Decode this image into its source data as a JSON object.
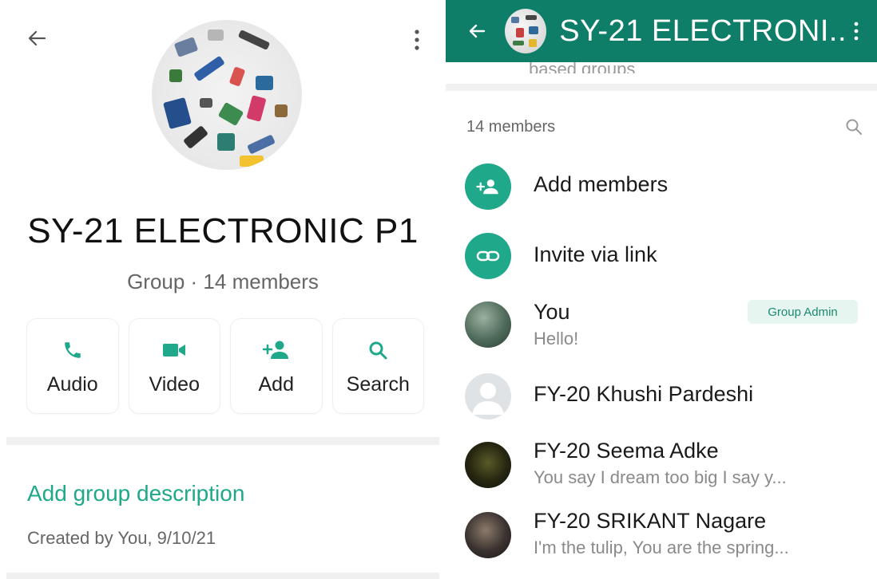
{
  "left": {
    "group_name": "SY-21 ELECTRONIC P1",
    "group_subtitle": "Group · 14 members",
    "actions": [
      {
        "label": "Audio",
        "icon": "phone-icon"
      },
      {
        "label": "Video",
        "icon": "video-icon"
      },
      {
        "label": "Add",
        "icon": "add-person-icon"
      },
      {
        "label": "Search",
        "icon": "search-icon"
      }
    ],
    "description_link": "Add group description",
    "created_by": "Created by You, 9/10/21"
  },
  "right": {
    "title": "SY-21 ELECTRONI..",
    "cut_text": "based groups",
    "members_count": "14 members",
    "add_members": "Add members",
    "invite_link": "Invite via link",
    "members": [
      {
        "name": "You",
        "status": "Hello!",
        "badge": "Group Admin"
      },
      {
        "name": "FY-20 Khushi Pardeshi",
        "status": ""
      },
      {
        "name": "FY-20 Seema Adke",
        "status": "You say I dream too big  I say y..."
      },
      {
        "name": "FY-20 SRIKANT Nagare",
        "status": "I'm the tulip, You are the spring..."
      }
    ]
  },
  "colors": {
    "accent": "#1fa88a",
    "header": "#0f7e69",
    "admin_badge_bg": "#e6f5ef"
  }
}
